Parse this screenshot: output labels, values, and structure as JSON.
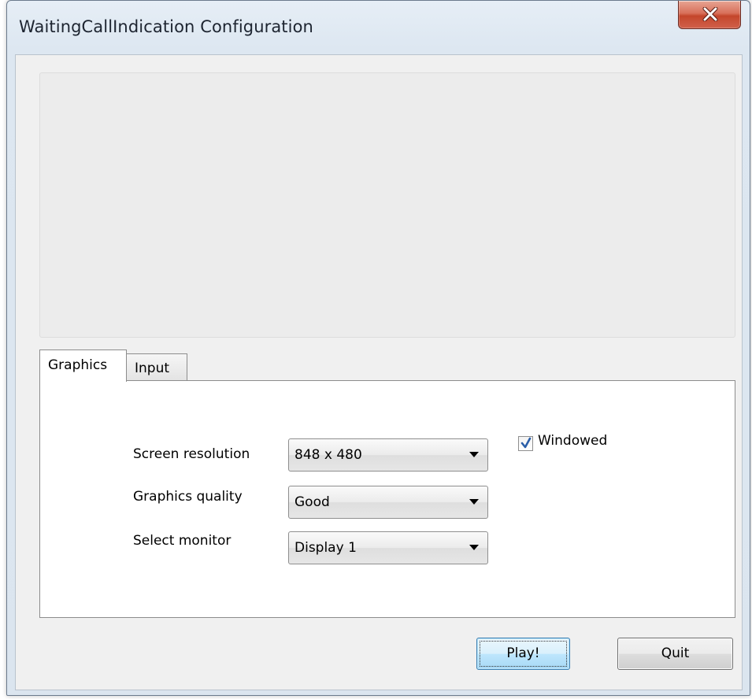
{
  "window": {
    "title": "WaitingCallIndication Configuration"
  },
  "tabs": [
    {
      "label": "Graphics",
      "selected": true
    },
    {
      "label": "Input",
      "selected": false
    }
  ],
  "graphics": {
    "screen_resolution": {
      "label": "Screen resolution",
      "value": "848 x 480"
    },
    "graphics_quality": {
      "label": "Graphics quality",
      "value": "Good"
    },
    "select_monitor": {
      "label": "Select monitor",
      "value": "Display 1"
    },
    "windowed": {
      "label": "Windowed",
      "checked": true
    }
  },
  "buttons": {
    "play": "Play!",
    "quit": "Quit"
  },
  "icons": {
    "close": "close-icon",
    "dropdown": "chevron-down-icon",
    "check": "checkmark-icon"
  },
  "colors": {
    "close_button": "#c4462c",
    "checkmark": "#2a5ea8",
    "default_button_border": "#3c7fb1"
  }
}
